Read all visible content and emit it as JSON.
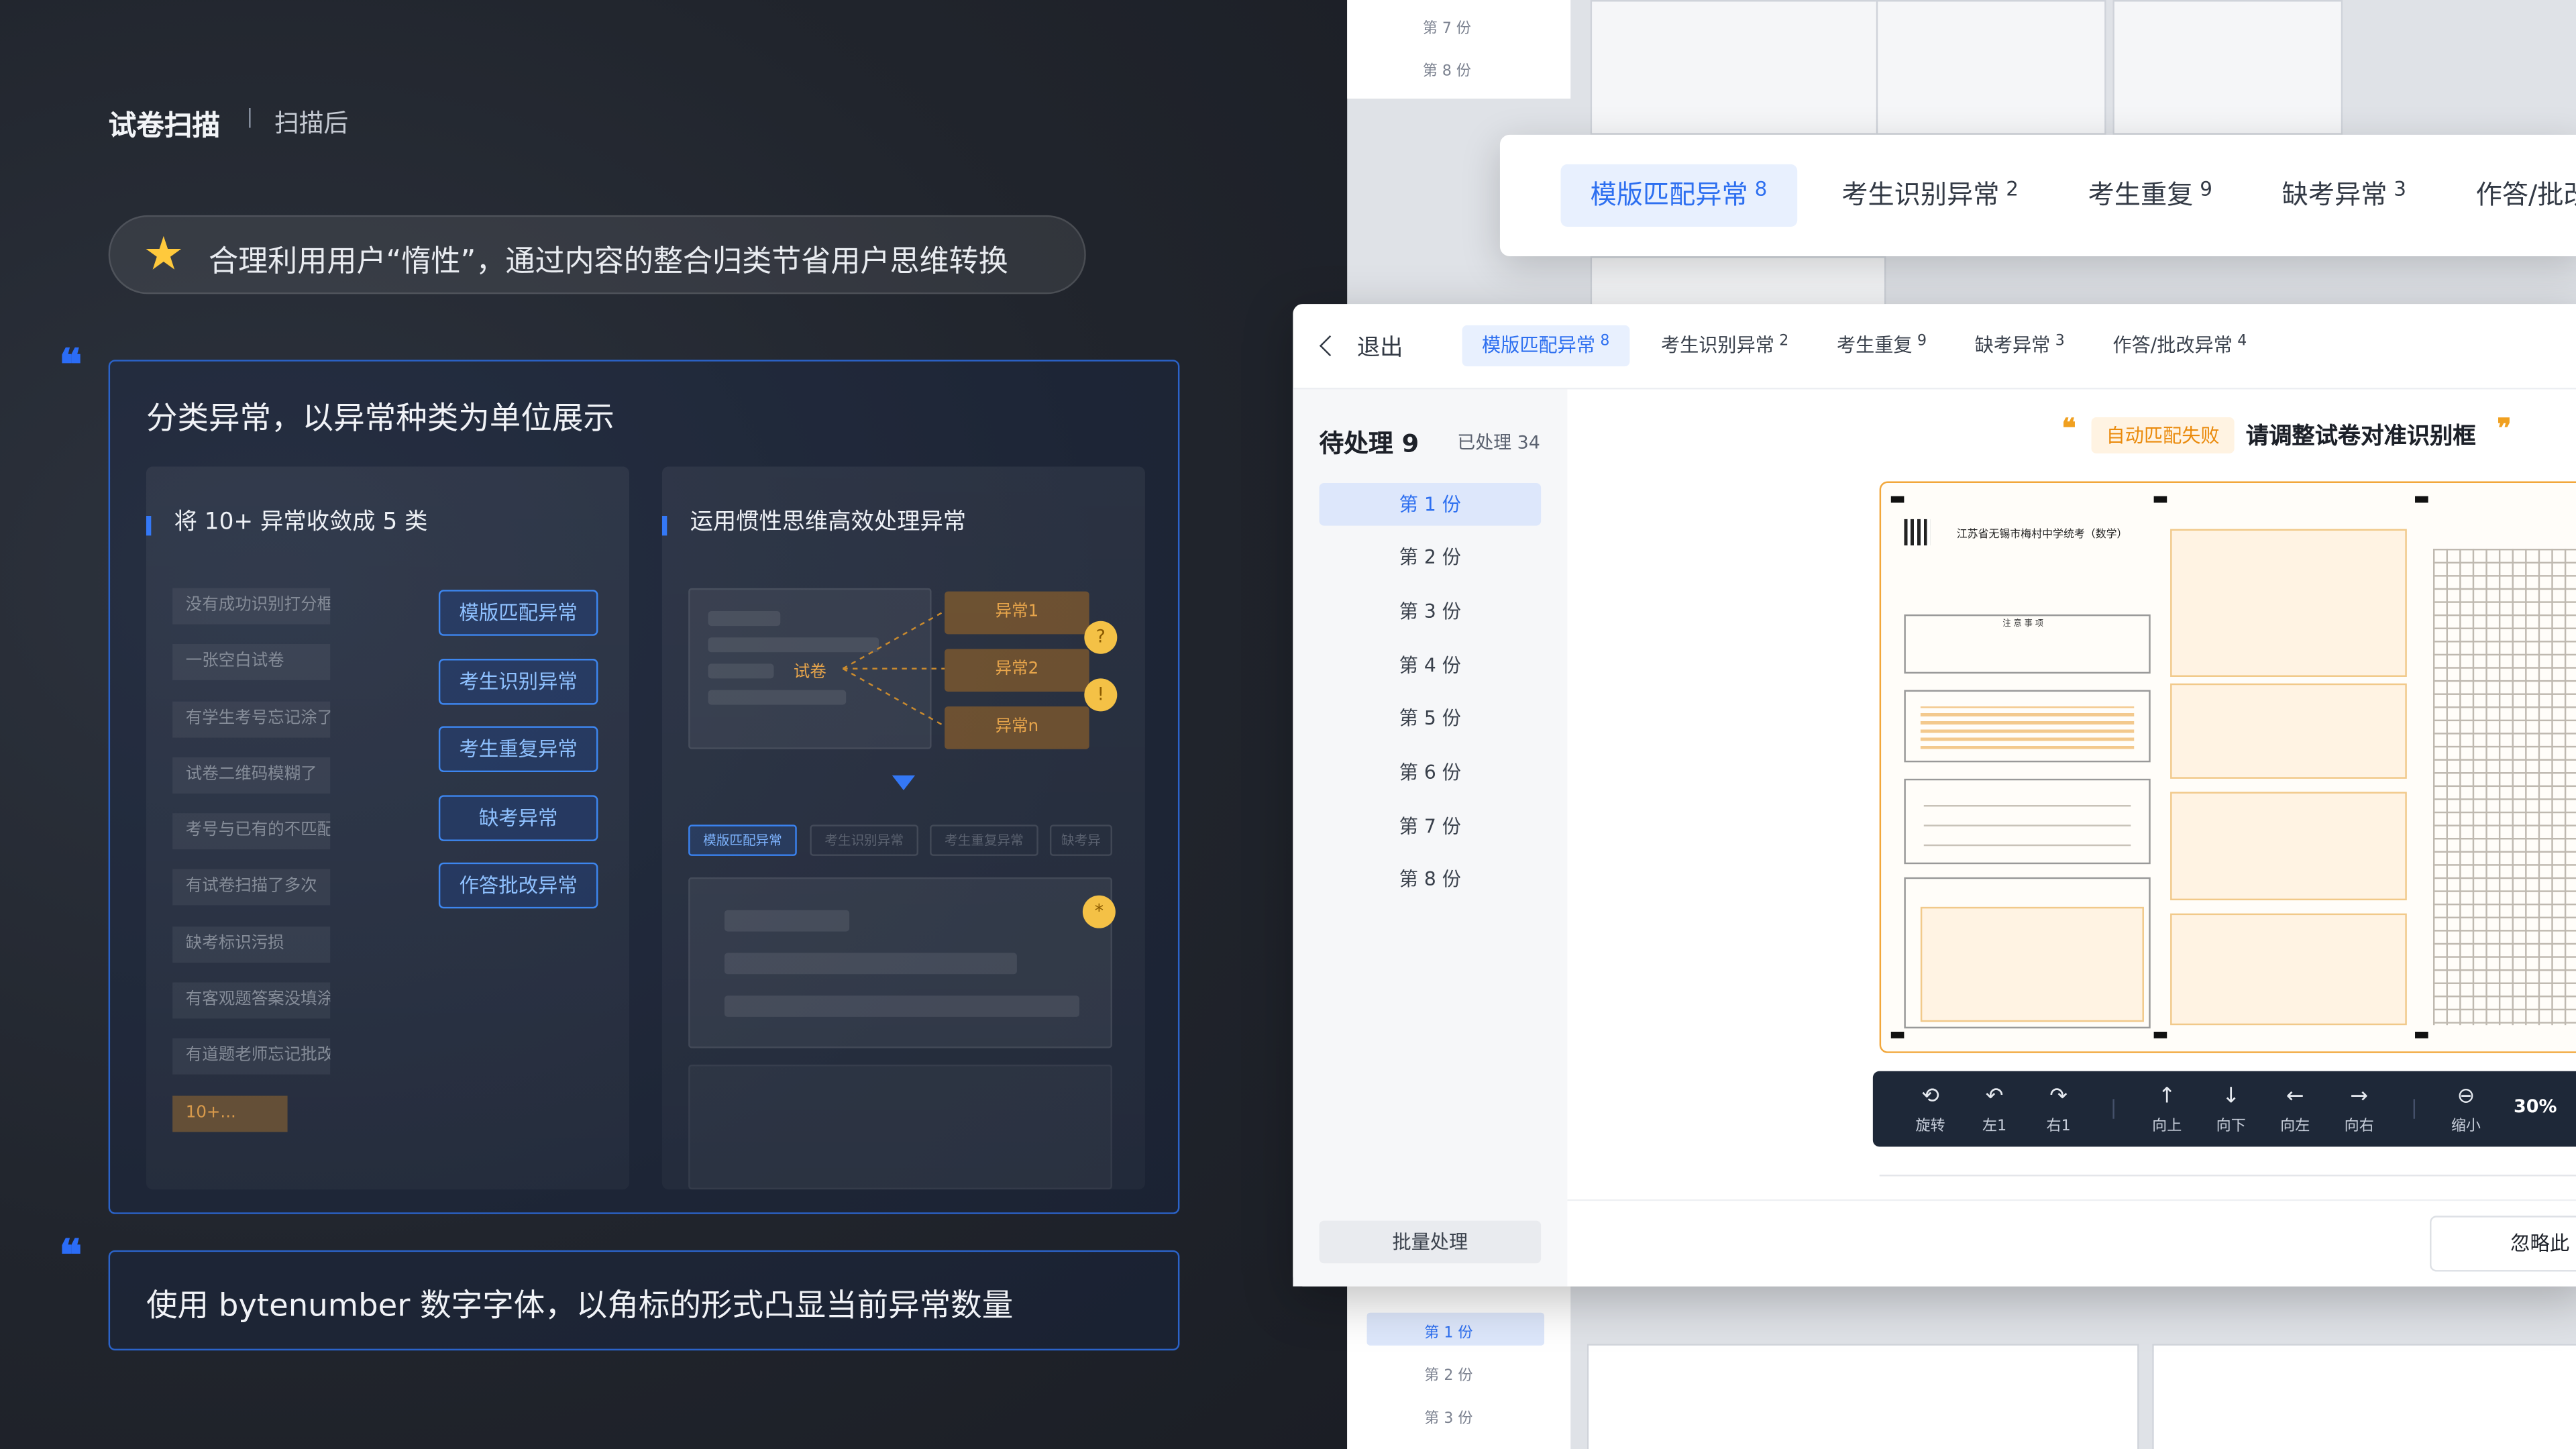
{
  "header": {
    "title": "试卷扫描",
    "separator": "|",
    "subtitle": "扫描后"
  },
  "pill": {
    "icon": "star-icon",
    "text": "合理利用用户“惰性”，通过内容的整合归类节省用户思维转换"
  },
  "section1": {
    "title": "分类异常，以异常种类为单位展示",
    "left": {
      "title": "将 10+ 异常收敛成 5 类",
      "raw_items": [
        "没有成功识别打分框",
        "一张空白试卷",
        "有学生考号忘记涂了",
        "试卷二维码模糊了",
        "考号与已有的不匹配",
        "有试卷扫描了多次",
        "缺考标识污损",
        "有客观题答案没填涂",
        "有道题老师忘记批改",
        "10+..."
      ],
      "categories": [
        "模版匹配异常",
        "考生识别异常",
        "考生重复异常",
        "缺考异常",
        "作答批改异常"
      ]
    },
    "right": {
      "title": "运用惯性思维高效处理异常",
      "paper_label": "试卷",
      "anomalies": [
        "异常1",
        "异常2",
        "异常n"
      ],
      "mini_tabs": [
        "模版匹配异常",
        "考生识别异常",
        "考生重复异常",
        "缺考异"
      ]
    }
  },
  "section2": {
    "title": "使用 bytenumber 数字字体，以角标的形式凸显当前异常数量"
  },
  "bg_list": {
    "top": [
      "第 7 份",
      "第 8 份"
    ],
    "bottom": [
      "第 1 份",
      "第 2 份",
      "第 3 份"
    ]
  },
  "big_tabs": [
    {
      "label": "模版匹配异常",
      "count": "8"
    },
    {
      "label": "考生识别异常",
      "count": "2"
    },
    {
      "label": "考生重复",
      "count": "9"
    },
    {
      "label": "缺考异常",
      "count": "3"
    },
    {
      "label": "作答/批改",
      "count": ""
    }
  ],
  "app": {
    "back_label": "退出",
    "tabs": [
      {
        "label": "模版匹配异常",
        "count": "8"
      },
      {
        "label": "考生识别异常",
        "count": "2"
      },
      {
        "label": "考生重复",
        "count": "9"
      },
      {
        "label": "缺考异常",
        "count": "3"
      },
      {
        "label": "作答/批改异常",
        "count": "4"
      }
    ],
    "pending_label": "待处理",
    "pending_count": "9",
    "done_label": "已处理 34",
    "copies": [
      "第 1 份",
      "第 2 份",
      "第 3 份",
      "第 4 份",
      "第 5 份",
      "第 6 份",
      "第 7 份",
      "第 8 份"
    ],
    "batch_label": "批量处理",
    "auto_fail": "自动匹配失败",
    "adjust_hint": "请调整试卷对准识别框",
    "sheet_title": "江苏省无锡市梅村中学统考（数学）",
    "sheet_notice": "注 意 事 项",
    "toolbar": [
      {
        "icon": "rotate-icon",
        "label": "旋转"
      },
      {
        "icon": "rotate-left-icon",
        "label": "左1"
      },
      {
        "icon": "rotate-right-icon",
        "label": "右1"
      },
      {
        "icon": "arrow-up-icon",
        "label": "向上"
      },
      {
        "icon": "arrow-down-icon",
        "label": "向下"
      },
      {
        "icon": "arrow-left-icon",
        "label": "向左"
      },
      {
        "icon": "arrow-right-icon",
        "label": "向右"
      },
      {
        "icon": "zoom-out-icon",
        "label": "缩小"
      }
    ],
    "zoom": "30%",
    "ignore_label": "忽略此"
  },
  "colors": {
    "accent": "#2d6ff0",
    "warning": "#ea8a0b",
    "dark_bg": "#21252d",
    "outline_blue": "#2b63c9"
  }
}
